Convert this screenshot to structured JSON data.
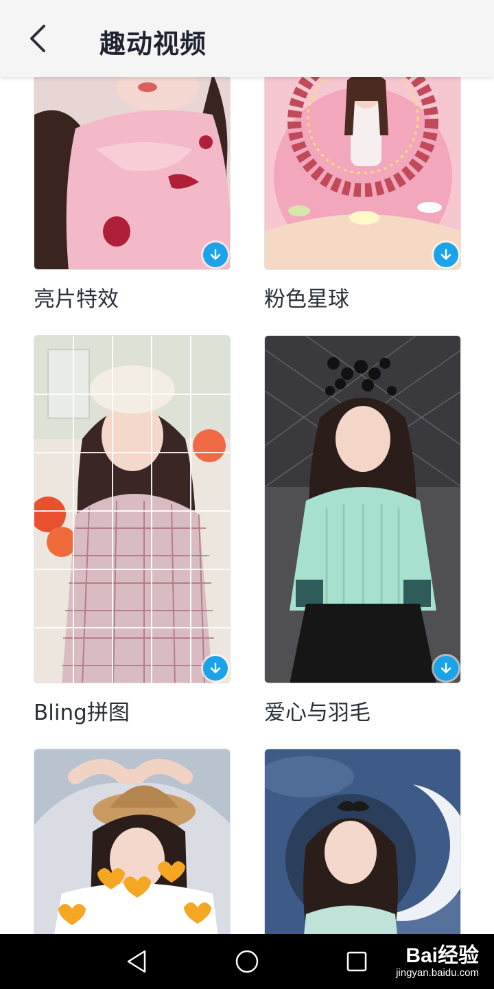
{
  "header": {
    "title": "趣动视频",
    "back_icon": "chevron-left-icon"
  },
  "effects": [
    {
      "label": "亮片特效",
      "icon": "download-icon"
    },
    {
      "label": "粉色星球",
      "icon": "download-icon"
    },
    {
      "label": "Bling拼图",
      "icon": "download-icon"
    },
    {
      "label": "爱心与羽毛",
      "icon": "download-icon"
    }
  ],
  "nav": {
    "back": "triangle-back-icon",
    "home": "circle-home-icon",
    "recent": "square-recent-icon"
  },
  "watermark": {
    "logo": "Bai经验",
    "url": "jingyan.baidu.com"
  },
  "colors": {
    "accent": "#1aa3e8",
    "header_bg": "#f5f5f6",
    "navbar_bg": "#000000"
  }
}
